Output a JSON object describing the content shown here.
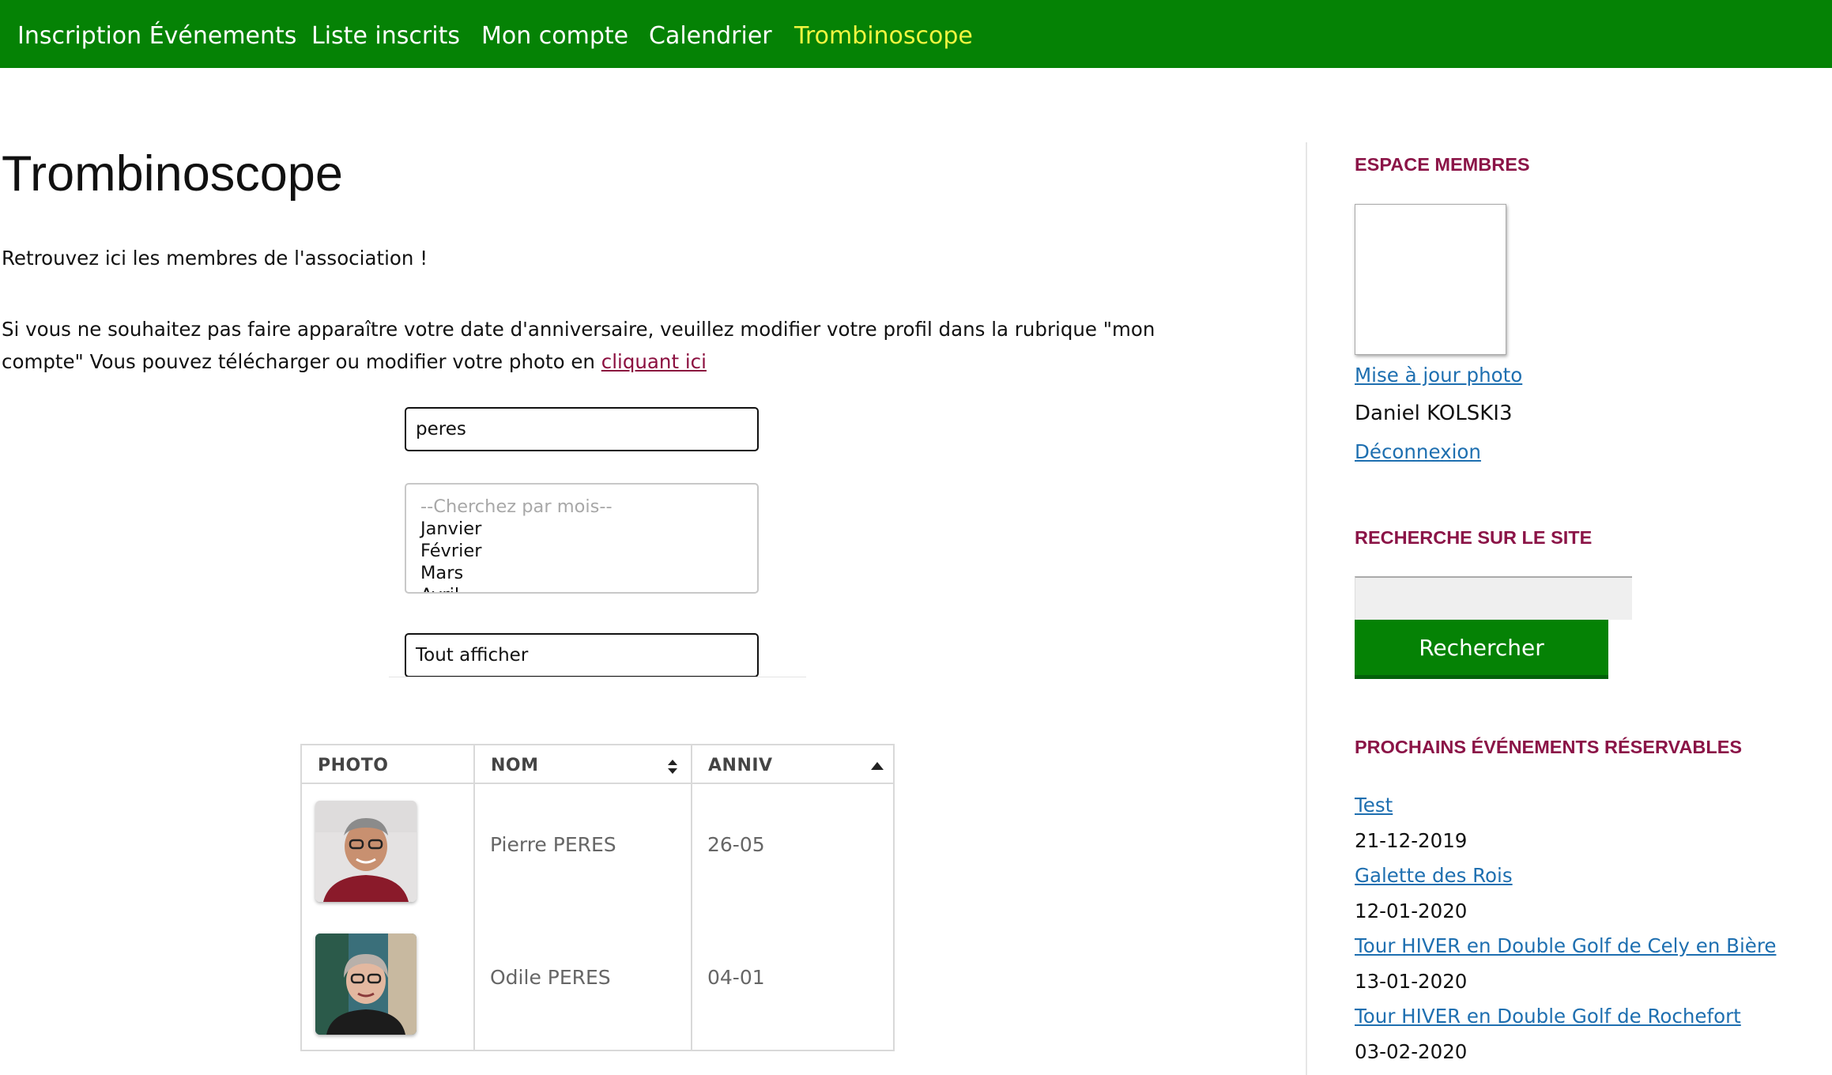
{
  "nav": {
    "items": [
      {
        "label": "Inscription Événements"
      },
      {
        "label": "Liste inscrits"
      },
      {
        "label": "Mon compte"
      },
      {
        "label": "Calendrier"
      },
      {
        "label": "Trombinoscope",
        "active": true
      }
    ]
  },
  "main": {
    "title": "Trombinoscope",
    "intro": "Retrouvez ici les membres de l'association !",
    "note_text": "Si vous ne souhaitez pas faire apparaître votre date d'anniversaire, veuillez modifier votre profil dans la rubrique \"mon compte\" Vous pouvez télécharger ou modifier votre photo en ",
    "note_link": "cliquant ici",
    "search_value": "peres",
    "month_select": {
      "placeholder": "--Cherchez par mois--",
      "options": [
        "Janvier",
        "Février",
        "Mars",
        "Avril"
      ]
    },
    "show_all_label": "Tout afficher"
  },
  "table": {
    "headers": {
      "photo": "PHOTO",
      "nom": "NOM",
      "anniv": "ANNIV"
    },
    "rows": [
      {
        "name": "Pierre PERES",
        "anniv": "26-05",
        "photo_icon": "man-portrait"
      },
      {
        "name": "Odile PERES",
        "anniv": "04-01",
        "photo_icon": "woman-portrait"
      }
    ]
  },
  "sidebar": {
    "members_heading": "ESPACE MEMBRES",
    "update_photo": "Mise à jour photo",
    "user_name": "Daniel KOLSKI3",
    "logout": "Déconnexion",
    "search_heading": "RECHERCHE SUR LE SITE",
    "search_button": "Rechercher",
    "events_heading": "PROCHAINS ÉVÉNEMENTS RÉSERVABLES",
    "events": [
      {
        "title": "Test",
        "date": "21-12-2019"
      },
      {
        "title": "Galette des Rois",
        "date": "12-01-2020"
      },
      {
        "title": "Tour HIVER en Double Golf de Cely en Bière",
        "date": "13-01-2020"
      },
      {
        "title": "Tour HIVER en Double Golf de Rochefort",
        "date": "03-02-2020"
      }
    ]
  },
  "colors": {
    "nav_bg": "#058205",
    "nav_active": "#f0f540",
    "heading_accent": "#8b1447",
    "link": "#1e6fb0"
  }
}
